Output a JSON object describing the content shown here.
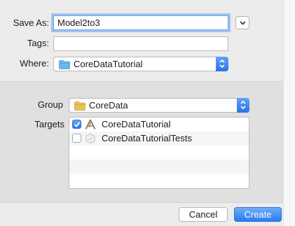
{
  "form": {
    "save_as_label": "Save As:",
    "save_as_value": "Model2to3",
    "tags_label": "Tags:",
    "tags_value": "",
    "where_label": "Where:",
    "where_value": "CoreDataTutorial"
  },
  "options": {
    "group_label": "Group",
    "group_value": "CoreData",
    "targets_label": "Targets",
    "targets": [
      {
        "name": "CoreDataTutorial",
        "checked": true,
        "icon": "app-target-icon"
      },
      {
        "name": "CoreDataTutorialTests",
        "checked": false,
        "icon": "test-target-icon"
      }
    ]
  },
  "buttons": {
    "cancel": "Cancel",
    "create": "Create"
  },
  "colors": {
    "accent": "#2d7bee",
    "folder": "#6bb8f0",
    "group_folder": "#e8c35a"
  }
}
